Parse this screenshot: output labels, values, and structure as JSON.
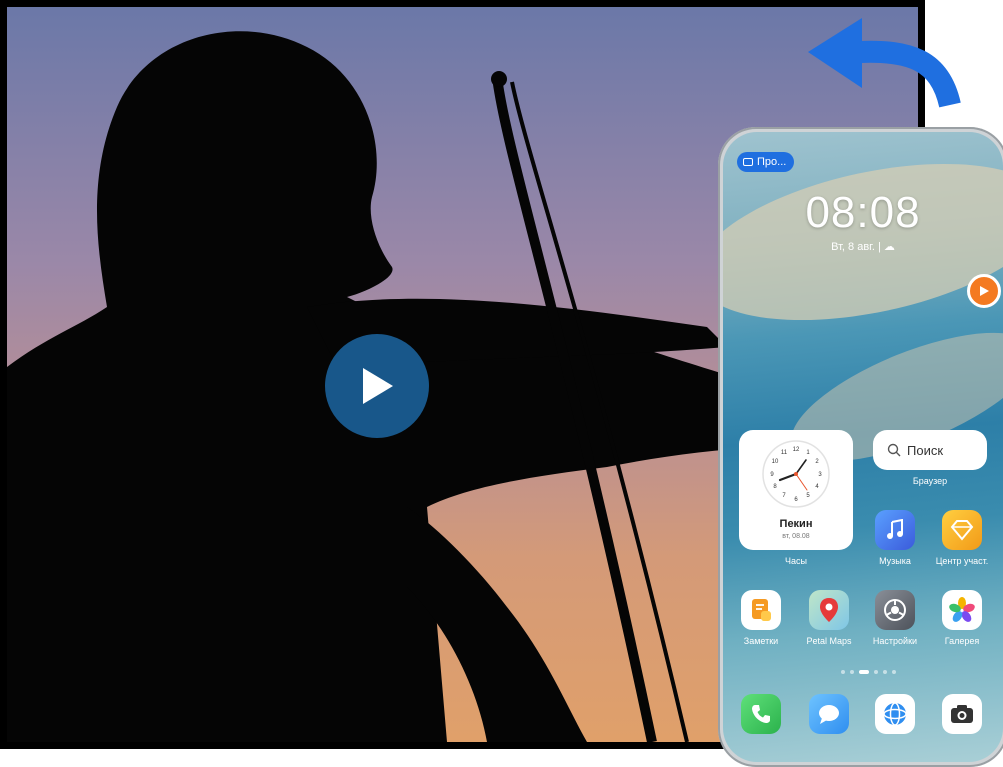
{
  "tv": {
    "play_icon": "play-icon"
  },
  "share_arrow_icon": "curved-arrow-icon",
  "phone": {
    "projection_chip": "Про...",
    "time": "08:08",
    "date": "Вт, 8 авг. | ☁",
    "clock_widget": {
      "numbers": [
        "12",
        "1",
        "2",
        "3",
        "4",
        "5",
        "6",
        "7",
        "8",
        "9",
        "10",
        "11"
      ],
      "city": "Пекин",
      "date": "вт, 08.08",
      "label": "Часы"
    },
    "search_widget": {
      "placeholder": "Поиск",
      "label": "Браузер"
    },
    "apps": {
      "music": "Музыка",
      "member_center": "Центр участ.",
      "notes": "Заметки",
      "petal_maps": "Petal Maps",
      "settings": "Настройки",
      "gallery": "Галерея"
    },
    "dock": [
      "phone-icon",
      "messages-icon",
      "browser-icon",
      "camera-icon"
    ],
    "colors": {
      "accent": "#1f6fe0",
      "play_button": "#1a5e96",
      "float_button": "#f47a21"
    }
  }
}
